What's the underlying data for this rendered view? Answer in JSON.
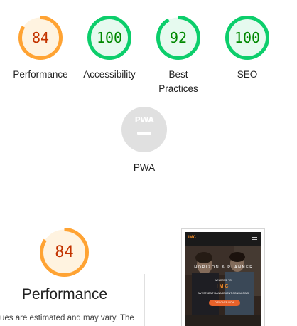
{
  "summary_gauges": [
    {
      "name": "performance",
      "score": "84",
      "label": "Performance",
      "status": "average"
    },
    {
      "name": "accessibility",
      "score": "100",
      "label": "Accessibility",
      "status": "pass"
    },
    {
      "name": "best-practices",
      "score": "92",
      "label_line1": "Best",
      "label_line2": "Practices",
      "status": "pass"
    },
    {
      "name": "seo",
      "score": "100",
      "label": "SEO",
      "status": "pass"
    },
    {
      "name": "pwa",
      "badge": "PWA",
      "label": "PWA",
      "status": "not-applicable"
    }
  ],
  "score_fractions": {
    "performance": 0.84,
    "accessibility": 1.0,
    "best_practices": 0.92,
    "seo": 1.0
  },
  "detail": {
    "score": "84",
    "title": "Performance",
    "note": "ues are estimated and may vary. The"
  },
  "screenshot_preview": {
    "logo": "IMC",
    "hero_title": "HORIZON & PLANNER",
    "welcome": "WELCOME TO",
    "brand": "IMC",
    "subtitle": "INVESTMENT MANAGEMENT CONSULTING",
    "cta": "DISCOVER NOW"
  },
  "colors": {
    "average_stroke": "#ffa333",
    "average_fill": "#fff3e0",
    "average_text": "#c33300",
    "pass_stroke": "#0cce6b",
    "pass_fill": "#e6faef",
    "pass_text": "#008800",
    "na_fill": "#e0e0e0",
    "na_text": "#ffffff"
  }
}
